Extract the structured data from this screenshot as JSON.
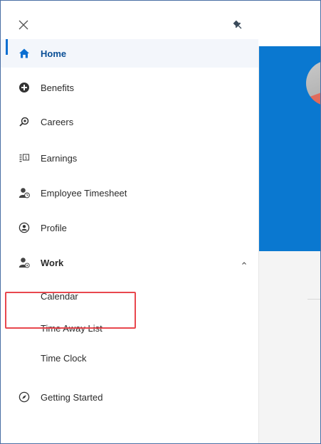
{
  "nav": {
    "items": [
      {
        "label": "Home",
        "icon": "home-icon",
        "active": true
      },
      {
        "label": "Benefits",
        "icon": "plus-circle-icon"
      },
      {
        "label": "Careers",
        "icon": "search-icon"
      },
      {
        "label": "Earnings",
        "icon": "earnings-icon"
      },
      {
        "label": "Employee Timesheet",
        "icon": "user-clock-icon"
      },
      {
        "label": "Profile",
        "icon": "user-circle-icon"
      },
      {
        "label": "Work",
        "icon": "user-work-icon",
        "expanded": true
      },
      {
        "label": "Getting Started",
        "icon": "compass-icon"
      }
    ],
    "work_subitems": [
      {
        "label": "Calendar"
      },
      {
        "label": "Time Away List"
      },
      {
        "label": "Time Clock",
        "highlighted": true
      }
    ]
  },
  "colors": {
    "accent": "#0a6ed1",
    "banner": "#0a78d0",
    "highlight": "#e8474e",
    "text": "#2b2b2b"
  }
}
